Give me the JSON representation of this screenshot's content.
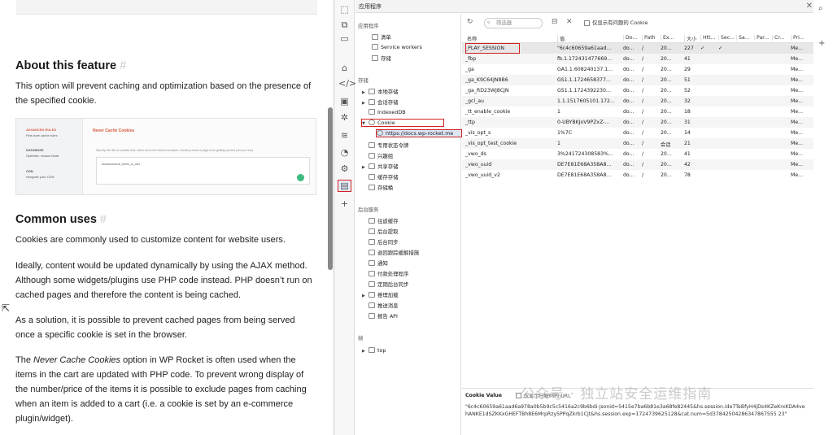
{
  "doc": {
    "heading_about": "About this feature",
    "heading_hash": "#",
    "about_text": "This option will prevent caching and optimization based on the presence of the specified cookie.",
    "feature_image": {
      "sidebar_title": "ADVANCED RULES",
      "sidebar_sub": "Fine-tune cache rules",
      "item_database": "DATABASE",
      "item_database_sub": "Optimize, reduce bloat",
      "item_cdn": "CDN",
      "item_cdn_sub": "Integrate your CDN",
      "panel_title": "Never Cache Cookies",
      "panel_desc": "Specify the IDs of cookies that, when set in the visitor's browser, should prevent a page from getting cached (one per line)",
      "textarea_value": "woocommerce_items_in_cart"
    },
    "heading_common": "Common uses",
    "p1": "Cookies are commonly used to customize content for website users.",
    "p2": "Ideally, content would be updated dynamically by using the AJAX method. Although some widgets/plugins use PHP code instead. PHP doesn’t run on cached pages and therefore the content is being cached.",
    "p3": "As a solution, it is possible to prevent cached pages from being served once a specific cookie is set in the browser.",
    "p4_pre": "The ",
    "p4_em": "Never Cache Cookies",
    "p4_post": " option in WP Rocket is often used when the items in the cart are updated with PHP code. To prevent wrong display of the number/price of the items it is possible to exclude pages from caching when an item is added to a cart (i.e. a cookie is set by an e-commerce plugin/widget)."
  },
  "devtools": {
    "title": "应用程序",
    "close": "✕",
    "tree": {
      "section_app": "应用程序",
      "manifest": "清单",
      "service_workers": "Service workers",
      "storage_item": "存储",
      "section_storage": "存储",
      "local_storage": "本地存储",
      "session_storage": "会话存储",
      "indexeddb": "IndexedDB",
      "cookie": "Cookie",
      "cookie_origin": "https://docs.wp-rocket.me",
      "private_state_tokens": "专用状态令牌",
      "interest_groups": "兴趣组",
      "shared_storage": "共享存储",
      "cache_storage": "缓存存储",
      "storage_buckets": "存储桶",
      "section_bg": "后台服务",
      "bfcache": "往返缓存",
      "bg_fetch": "后台提取",
      "bg_sync": "后台同步",
      "bounce_tracking": "退回跟踪缓解措施",
      "notifications": "通知",
      "payment_handler": "付款处理程序",
      "periodic_sync": "定期后台同步",
      "speculative_loads": "推理加载",
      "push_messaging": "推送消息",
      "reporting_api": "报告 API",
      "section_frames": "帧",
      "top": "top"
    },
    "toolbar": {
      "filter_placeholder": "筛选器",
      "only_issues_label": "仅显示有问题的 Cookie"
    },
    "columns": [
      "名称",
      "值",
      "Do...",
      "Path",
      "Ex...",
      "大小",
      "Htt...",
      "Sec...",
      "Sa...",
      "Par...",
      "Cr...",
      "Pri..."
    ],
    "rows": [
      [
        "_PLAY_SESSION",
        "\"6c4c60659a61aad...",
        "do...",
        "/",
        "20...",
        "227",
        "✓",
        "✓",
        "",
        "",
        "",
        "Me..."
      ],
      [
        "_fbp",
        "fb.1.172431477669...",
        "do...",
        "/",
        "20...",
        "41",
        "",
        "",
        "",
        "",
        "",
        "Me..."
      ],
      [
        "_ga",
        "GA1.1.608240137.1...",
        "do...",
        "/",
        "20...",
        "29",
        "",
        "",
        "",
        "",
        "",
        "Me..."
      ],
      [
        "_ga_K9C64JN8B6",
        "GS1.1.1724658377...",
        "do...",
        "/",
        "20...",
        "51",
        "",
        "",
        "",
        "",
        "",
        "Me..."
      ],
      [
        "_ga_RD23WJ8CJN",
        "GS1.1.1724392230...",
        "do...",
        "/",
        "20...",
        "52",
        "",
        "",
        "",
        "",
        "",
        "Me..."
      ],
      [
        "_gcl_au",
        "1.1.1517605101.172...",
        "do...",
        "/",
        "20...",
        "32",
        "",
        "",
        "",
        "",
        "",
        "Me..."
      ],
      [
        "_tt_enable_cookie",
        "1",
        "do...",
        "/",
        "20...",
        "18",
        "",
        "",
        "",
        "",
        "",
        "Me..."
      ],
      [
        "_ttp",
        "0-UBYBKJoV9PZxZ-...",
        "do...",
        "/",
        "20...",
        "31",
        "",
        "",
        "",
        "",
        "",
        "Me..."
      ],
      [
        "_vis_opt_s",
        "1%7C",
        "do...",
        "/",
        "20...",
        "14",
        "",
        "",
        "",
        "",
        "",
        "Me..."
      ],
      [
        "_vis_opt_test_cookie",
        "1",
        "do...",
        "/",
        "会话",
        "21",
        "",
        "",
        "",
        "",
        "",
        "Me..."
      ],
      [
        "_vwo_ds",
        "3%241724308583%...",
        "do...",
        "/",
        "20...",
        "41",
        "",
        "",
        "",
        "",
        "",
        "Me..."
      ],
      [
        "_vwo_uuid",
        "DE7E81E68A358A8...",
        "do...",
        "/",
        "20...",
        "42",
        "",
        "",
        "",
        "",
        "",
        "Me..."
      ],
      [
        "_vwo_uuid_v2",
        "DE7E81E68A358A8...",
        "do...",
        "/",
        "20...",
        "78",
        "",
        "",
        "",
        "",
        "",
        "Me..."
      ]
    ],
    "cookie_value": {
      "label": "Cookie Value",
      "decode_label": "仅显示已解码的 URL",
      "value": "\"6c4c60659a61aad6a978a0b5b9c5c5416a2c9b6bdi-jsonid=5415e7ba6b81e3a68fe82445&hs.session.ide7TeBfyH4jDs4KZeKrxKDA4vehANKE1dSZKKxGHEFTBh8E6MrpRzy5PPqZkrb1Cjt&hs.session.exp=1724739625128&cat.num=5d37842504286347867555 23\""
    },
    "watermark": "公众号 · 独立站安全运维指南"
  }
}
